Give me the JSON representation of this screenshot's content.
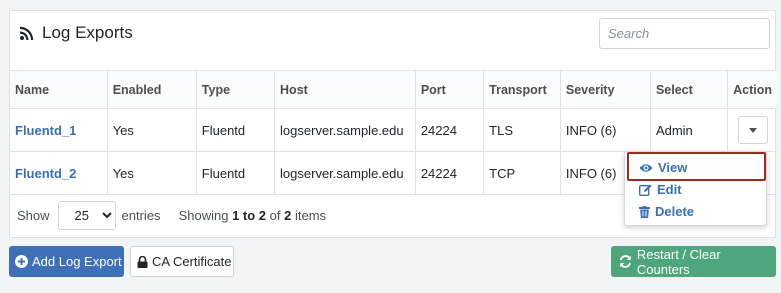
{
  "header": {
    "title": "Log Exports",
    "search_placeholder": "Search"
  },
  "table": {
    "columns": [
      "Name",
      "Enabled",
      "Type",
      "Host",
      "Port",
      "Transport",
      "Severity",
      "Select",
      "Action"
    ],
    "rows": [
      {
        "name": "Fluentd_1",
        "enabled": "Yes",
        "type": "Fluentd",
        "host": "logserver.sample.edu",
        "port": "24224",
        "transport": "TLS",
        "severity": "INFO (6)",
        "select": "Admin"
      },
      {
        "name": "Fluentd_2",
        "enabled": "Yes",
        "type": "Fluentd",
        "host": "logserver.sample.edu",
        "port": "24224",
        "transport": "TCP",
        "severity": "INFO (6)",
        "select": ""
      }
    ]
  },
  "footer": {
    "show_label": "Show",
    "page_size": "25",
    "entries_label": "entries",
    "showing_label": "Showing",
    "range": "1 to 2",
    "of_label": "of",
    "total": "2",
    "items_label": "items"
  },
  "action_menu": {
    "view": "View",
    "edit": "Edit",
    "delete": "Delete"
  },
  "buttons": {
    "add": "Add Log Export",
    "ca": "CA Certificate",
    "restart": "Restart / Clear Counters"
  },
  "colors": {
    "primary": "#3f6fb6",
    "success": "#4fa67c",
    "link": "#3a6fb0",
    "highlight": "#9c2a1e"
  },
  "icons": {
    "title": "rss-icon",
    "action": "caret-down-icon",
    "view": "eye-icon",
    "edit": "edit-icon",
    "delete": "trash-icon",
    "add": "plus-circle-icon",
    "ca": "lock-icon",
    "restart": "sync-icon"
  }
}
